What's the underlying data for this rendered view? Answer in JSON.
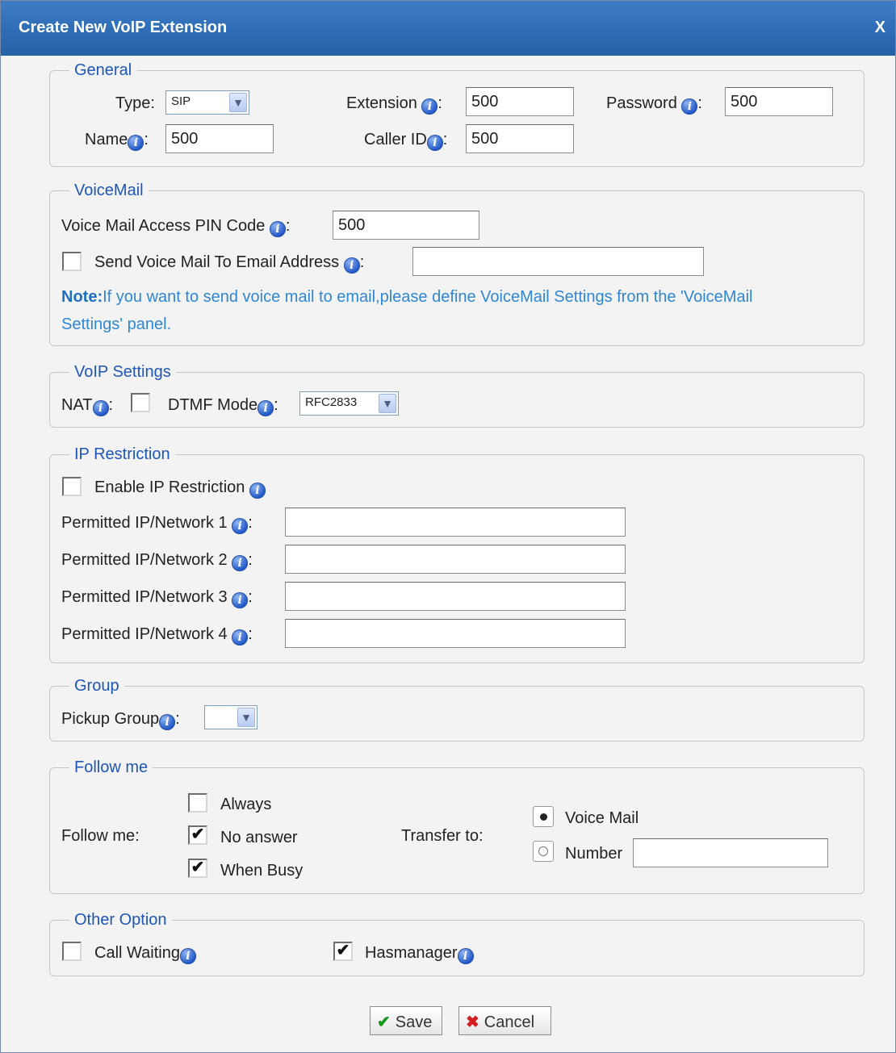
{
  "title": "Create New VoIP Extension",
  "close_label": "X",
  "general": {
    "legend": "General",
    "type_label": "Type:",
    "type_value": "SIP",
    "extension_label": "Extension",
    "extension_value": "500",
    "password_label": "Password",
    "password_value": "500",
    "name_label": "Name",
    "name_value": "500",
    "callerid_label": "Caller ID",
    "callerid_value": "500"
  },
  "voicemail": {
    "legend": "VoiceMail",
    "pin_label": "Voice Mail Access PIN Code",
    "pin_value": "500",
    "send_label": "Send Voice Mail To Email Address",
    "send_checked": false,
    "email_value": "",
    "note_bold": "Note:",
    "note_line1": "If you want to send voice mail to email,please define VoiceMail Settings from the 'VoiceMail",
    "note_line2": "Settings' panel."
  },
  "voip": {
    "legend": "VoIP Settings",
    "nat_label": "NAT",
    "nat_checked": false,
    "dtmf_label": "DTMF Mode",
    "dtmf_value": "RFC2833"
  },
  "ip": {
    "legend": "IP Restriction",
    "enable_label": "Enable IP Restriction",
    "enable_checked": false,
    "permitted": [
      {
        "label": "Permitted IP/Network 1",
        "value": ""
      },
      {
        "label": "Permitted IP/Network 2",
        "value": ""
      },
      {
        "label": "Permitted IP/Network 3",
        "value": ""
      },
      {
        "label": "Permitted IP/Network 4",
        "value": ""
      }
    ]
  },
  "group": {
    "legend": "Group",
    "pickup_label": "Pickup Group",
    "pickup_value": ""
  },
  "followme": {
    "legend": "Follow me",
    "label": "Follow me:",
    "always_label": "Always",
    "always_checked": false,
    "noanswer_label": "No answer",
    "noanswer_checked": true,
    "busy_label": "When Busy",
    "busy_checked": true,
    "transfer_label": "Transfer to:",
    "voicemail_label": "Voice Mail",
    "voicemail_selected": true,
    "number_label": "Number",
    "number_value": ""
  },
  "other": {
    "legend": "Other Option",
    "callwaiting_label": "Call Waiting",
    "callwaiting_checked": false,
    "hasmanager_label": "Hasmanager",
    "hasmanager_checked": true
  },
  "buttons": {
    "save": "Save",
    "cancel": "Cancel"
  },
  "colors": {
    "title_bar": "#2e6db6",
    "legend": "#1d56b8",
    "note": "#2f86d4"
  },
  "icons": {
    "info": "info-icon",
    "save": "check-icon",
    "cancel": "x-icon"
  }
}
